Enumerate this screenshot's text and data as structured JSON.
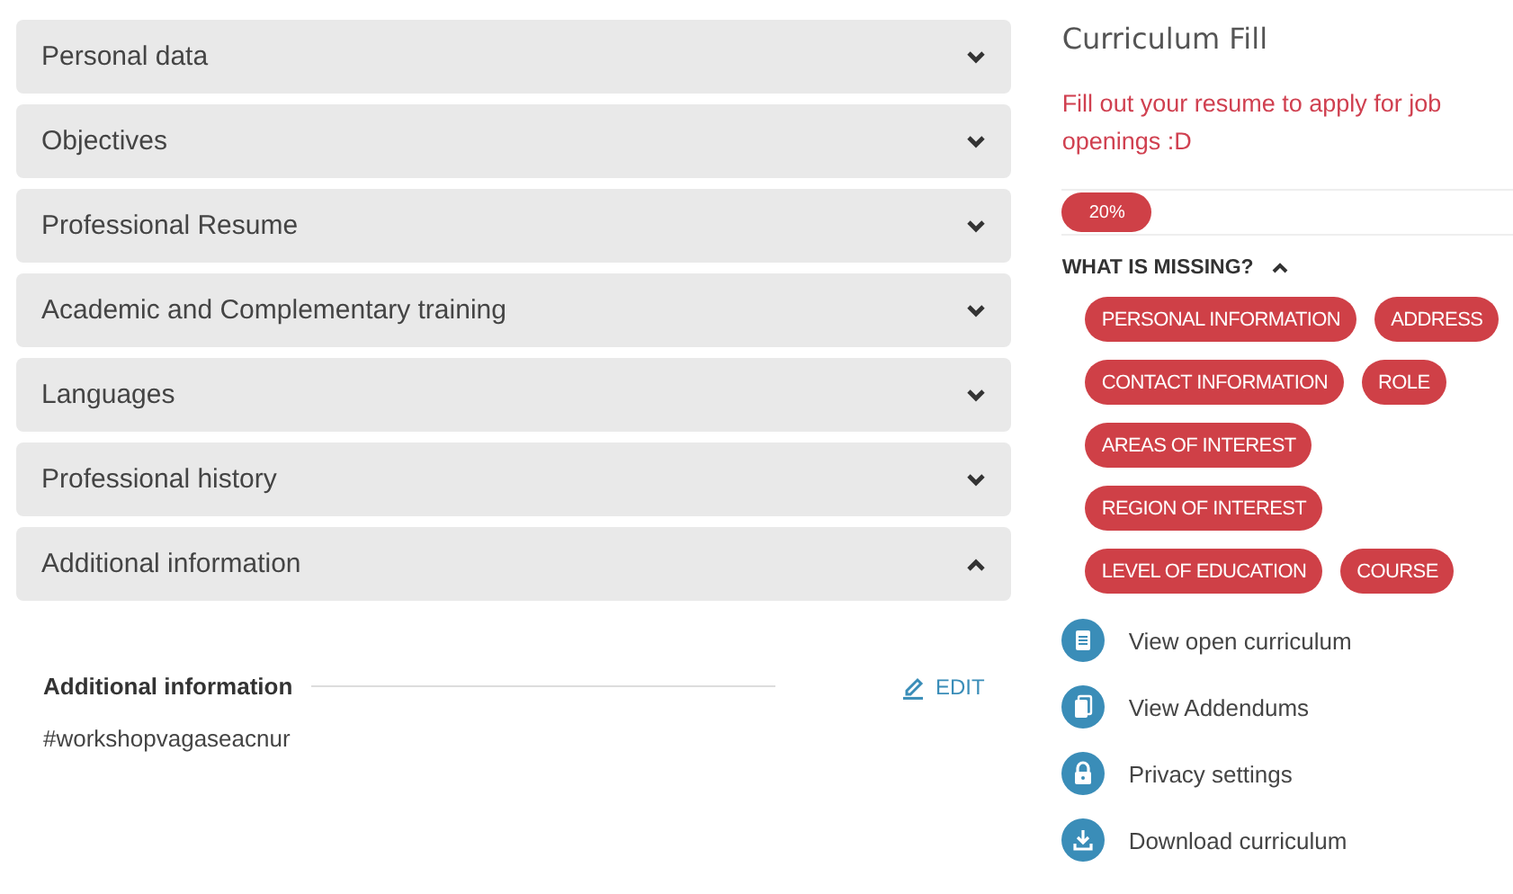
{
  "accordion": [
    {
      "label": "Personal data",
      "expanded": false
    },
    {
      "label": "Objectives",
      "expanded": false
    },
    {
      "label": "Professional Resume",
      "expanded": false
    },
    {
      "label": "Academic and Complementary training",
      "expanded": false
    },
    {
      "label": "Languages",
      "expanded": false
    },
    {
      "label": "Professional history",
      "expanded": false
    },
    {
      "label": "Additional information",
      "expanded": true
    }
  ],
  "detail": {
    "heading": "Additional information",
    "edit_label": "EDIT",
    "text": "#workshopvagaseacnur"
  },
  "sidebar": {
    "title": "Curriculum Fill",
    "message": "Fill out your resume to apply for job openings :D",
    "progress": {
      "level": 0.2,
      "reading": "20%"
    },
    "missing": {
      "label": "WHAT IS MISSING?",
      "expanded": true,
      "rows": [
        [
          "PERSONAL INFORMATION",
          "ADDRESS"
        ],
        [
          "CONTACT INFORMATION",
          "ROLE"
        ],
        [
          "AREAS OF INTEREST"
        ],
        [
          "REGION OF INTEREST"
        ],
        [
          "LEVEL OF EDUCATION",
          "COURSE"
        ]
      ]
    },
    "links": [
      {
        "kind": "document",
        "label": "View open curriculum"
      },
      {
        "kind": "documents",
        "label": "View Addendums"
      },
      {
        "kind": "lock",
        "label": "Privacy settings"
      },
      {
        "kind": "download",
        "label": "Download curriculum"
      }
    ]
  }
}
